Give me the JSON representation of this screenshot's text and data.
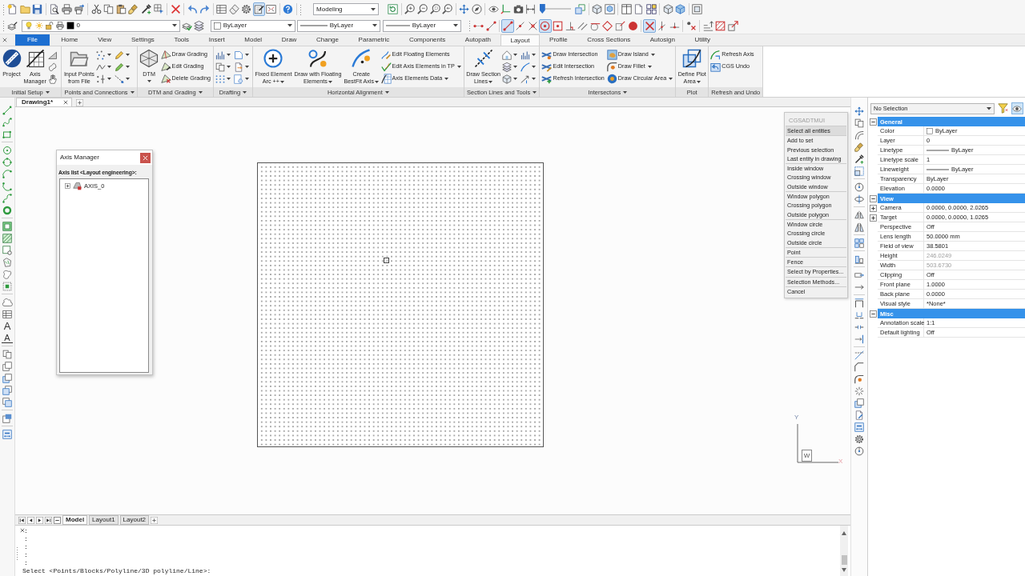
{
  "standard_toolbar": {
    "buttons": [
      {
        "on": false
      },
      {
        "on": false
      },
      {
        "on": false
      },
      {
        "on": false
      },
      {
        "on": false
      },
      {
        "on": false
      },
      {
        "on": false
      },
      {
        "on": false
      },
      {
        "on": false
      },
      {
        "on": false
      },
      {
        "on": false
      },
      {
        "on": false
      },
      {
        "on": false
      },
      {
        "on": false
      },
      {
        "on": false
      },
      {
        "on": false
      },
      {
        "on": false
      },
      {
        "on": false
      },
      {
        "on": true
      },
      {
        "on": false
      },
      {
        "on": false
      }
    ],
    "workspace": "Modeling",
    "view_buttons": [
      {
        "on": false
      },
      {
        "on": false
      },
      {
        "on": false
      },
      {
        "on": false
      },
      {
        "on": false
      },
      {
        "on": false
      },
      {
        "on": false
      },
      {
        "on": false
      },
      {
        "on": false
      },
      {
        "on": false
      },
      {
        "on": false
      },
      {
        "on": false
      },
      {
        "on": false
      },
      {
        "on": false
      },
      {
        "on": false
      },
      {
        "on": false
      },
      {
        "on": false
      },
      {
        "on": false
      },
      {
        "on": false
      },
      {
        "on": false
      }
    ],
    "visual_slider": {
      "level": 0
    }
  },
  "property_toolbar": {
    "layer": "0",
    "color_setting": "ByLayer",
    "linetype": "ByLayer",
    "lineweight": "ByLayer"
  },
  "snap_toolbar": {
    "buttons": [
      {
        "on": false
      },
      {
        "on": false
      },
      {
        "on": true
      },
      {
        "on": false
      },
      {
        "on": false
      },
      {
        "on": true
      },
      {
        "on": false
      },
      {
        "on": false
      },
      {
        "on": false
      },
      {
        "on": false
      },
      {
        "on": false
      },
      {
        "on": false
      },
      {
        "on": false
      },
      {
        "on": true
      },
      {
        "on": false
      },
      {
        "on": false
      },
      {
        "on": false
      },
      {
        "on": false
      },
      {
        "on": false
      },
      {
        "on": false
      }
    ]
  },
  "ribbon_tabs": [
    {
      "label": "File",
      "kind": "application",
      "selected": false
    },
    {
      "label": "Home",
      "kind": "tab",
      "selected": false
    },
    {
      "label": "View",
      "kind": "tab",
      "selected": false
    },
    {
      "label": "Settings",
      "kind": "tab",
      "selected": false
    },
    {
      "label": "Tools",
      "kind": "tab",
      "selected": false
    },
    {
      "label": "Insert",
      "kind": "tab",
      "selected": false
    },
    {
      "label": "Model",
      "kind": "tab",
      "selected": false
    },
    {
      "label": "Draw",
      "kind": "tab",
      "selected": false
    },
    {
      "label": "Change",
      "kind": "tab",
      "selected": false
    },
    {
      "label": "Parametric",
      "kind": "tab",
      "selected": false
    },
    {
      "label": "Components",
      "kind": "tab",
      "selected": false
    },
    {
      "label": "Autopath",
      "kind": "tab",
      "selected": false
    },
    {
      "label": "Layout",
      "kind": "tab",
      "selected": true
    },
    {
      "label": "Profile",
      "kind": "tab",
      "selected": false
    },
    {
      "label": "Cross Sections",
      "kind": "tab",
      "selected": false
    },
    {
      "label": "Autosign",
      "kind": "tab",
      "selected": false
    },
    {
      "label": "Utility",
      "kind": "tab",
      "selected": false
    }
  ],
  "ribbon_groups": [
    {
      "label": "Initial Setup",
      "menu": true,
      "tools": [
        {
          "kind": "large",
          "label": "Project",
          "menu": false
        },
        {
          "kind": "large",
          "label": "Axis\nManager",
          "menu": false
        },
        {
          "kind": "icon",
          "menu": false
        },
        {
          "kind": "icon",
          "menu": false
        },
        {
          "kind": "icon",
          "menu": false
        }
      ]
    },
    {
      "label": "Points and Connections",
      "menu": true,
      "tools": [
        {
          "kind": "large",
          "label": "Input Points\nfrom File",
          "menu": false
        },
        {
          "kind": "icon",
          "menu": true
        },
        {
          "kind": "icon",
          "menu": true
        },
        {
          "kind": "icon",
          "menu": true
        },
        {
          "kind": "icon",
          "menu": true
        },
        {
          "kind": "icon",
          "menu": true
        },
        {
          "kind": "icon",
          "menu": true
        }
      ]
    },
    {
      "label": "DTM and Grading",
      "menu": true,
      "tools": [
        {
          "kind": "large",
          "label": "DTM",
          "menu": true
        },
        {
          "kind": "small",
          "label": "Draw Grading",
          "menu": false
        },
        {
          "kind": "small",
          "label": "Edit Grading",
          "menu": false
        },
        {
          "kind": "small",
          "label": "Delete Grading",
          "menu": false
        }
      ]
    },
    {
      "label": "Drafting",
      "menu": true,
      "tools": [
        {
          "kind": "icon",
          "menu": true
        },
        {
          "kind": "icon",
          "menu": true
        },
        {
          "kind": "icon",
          "menu": true
        },
        {
          "kind": "icon",
          "menu": true
        },
        {
          "kind": "icon",
          "menu": true
        },
        {
          "kind": "icon",
          "menu": true
        }
      ]
    },
    {
      "label": "Horizontal Alignment",
      "menu": true,
      "tools": [
        {
          "kind": "large",
          "label": "Fixed Element\nArc ++",
          "menu": true
        },
        {
          "kind": "large",
          "label": "Draw with Floating\nElements",
          "menu": true
        },
        {
          "kind": "large",
          "label": "Create\nBestFit Axis",
          "menu": true
        },
        {
          "kind": "small",
          "label": "Edit Floating Elements",
          "menu": false
        },
        {
          "kind": "small",
          "label": "Edit Axis Elements in TP",
          "menu": true
        },
        {
          "kind": "small",
          "label": "Axis Elements Data",
          "menu": true
        }
      ]
    },
    {
      "label": "Section Lines and Tools",
      "menu": true,
      "tools": [
        {
          "kind": "large",
          "label": "Draw Section\nLines",
          "menu": true
        },
        {
          "kind": "icon",
          "menu": true
        },
        {
          "kind": "icon",
          "menu": true
        },
        {
          "kind": "icon",
          "menu": true
        },
        {
          "kind": "icon",
          "menu": true
        },
        {
          "kind": "icon",
          "menu": true
        },
        {
          "kind": "icon",
          "menu": true
        }
      ]
    },
    {
      "label": "Intersectons",
      "menu": true,
      "tools": [
        {
          "kind": "small",
          "label": "Draw Intersection",
          "menu": false
        },
        {
          "kind": "small",
          "label": "Edit Intersection",
          "menu": false
        },
        {
          "kind": "small",
          "label": "Refresh Intersection",
          "menu": false
        },
        {
          "kind": "small",
          "label": "Draw Island",
          "menu": true
        },
        {
          "kind": "small",
          "label": "Draw Fillet",
          "menu": true
        },
        {
          "kind": "small",
          "label": "Draw Circular Area",
          "menu": true
        }
      ]
    },
    {
      "label": "Plot",
      "menu": false,
      "tools": [
        {
          "kind": "large",
          "label": "Define Plot\nArea",
          "menu": true
        }
      ]
    },
    {
      "label": "Refresh and Undo",
      "menu": false,
      "tools": [
        {
          "kind": "small",
          "label": "Refresh Axis",
          "menu": false
        },
        {
          "kind": "small",
          "label": "CGS Undo",
          "menu": false
        }
      ]
    }
  ],
  "document_tabs": [
    {
      "label": "Drawing1*",
      "selected": true
    }
  ],
  "draw_toolbar": {
    "text_tools": [
      {
        "glyph": "A",
        "kind": "single_line"
      },
      {
        "glyph": "A",
        "kind": "multiline"
      }
    ]
  },
  "axis_manager": {
    "title": "Axis Manager",
    "list_label": "Axis list <Layout engineering>:",
    "axes": [
      {
        "label": "AXIS_0",
        "expanded": false
      }
    ]
  },
  "selection_menu": {
    "title": "CGSADTMUI",
    "groups": [
      {
        "items": [
          {
            "label": "Select all entities",
            "selected": true
          }
        ]
      },
      {
        "items": [
          {
            "label": "Add to set",
            "selected": false
          },
          {
            "label": "Previous selection",
            "selected": false
          },
          {
            "label": "Last entity in drawing",
            "selected": false
          }
        ]
      },
      {
        "items": [
          {
            "label": "Inside window",
            "selected": false
          },
          {
            "label": "Crossing window",
            "selected": false
          },
          {
            "label": "Outside window",
            "selected": false
          }
        ]
      },
      {
        "items": [
          {
            "label": "Window polygon",
            "selected": false
          },
          {
            "label": "Crossing polygon",
            "selected": false
          },
          {
            "label": "Outside polygon",
            "selected": false
          }
        ]
      },
      {
        "items": [
          {
            "label": "Window circle",
            "selected": false
          },
          {
            "label": "Crossing circle",
            "selected": false
          },
          {
            "label": "Outside circle",
            "selected": false
          }
        ]
      },
      {
        "items": [
          {
            "label": "Point",
            "selected": false
          }
        ]
      },
      {
        "items": [
          {
            "label": "Fence",
            "selected": false
          }
        ]
      },
      {
        "items": [
          {
            "label": "Select by Properties...",
            "selected": false
          }
        ]
      },
      {
        "items": [
          {
            "label": "Selection Methods...",
            "selected": false
          }
        ]
      },
      {
        "items": [
          {
            "label": "Cancel",
            "selected": false
          }
        ]
      }
    ]
  },
  "ucs": {
    "y_label": "Y",
    "w_label": "W",
    "x_label": "X"
  },
  "layout_tabs": [
    {
      "label": "Model",
      "selected": true
    },
    {
      "label": "Layout1",
      "selected": false
    },
    {
      "label": "Layout2",
      "selected": false
    }
  ],
  "command_line": {
    "history": [
      ":",
      ":",
      ":",
      ":",
      ":"
    ],
    "prompt": "Select <Points/Blocks/Polyline/3D polyline/Line>:"
  },
  "properties": {
    "selector": "No Selection",
    "view_toggle": {
      "on": true
    },
    "sections": [
      {
        "title": "General",
        "expanded": true,
        "rows": [
          {
            "label": "Color",
            "value": "ByLayer",
            "kind": "color",
            "disabled": false
          },
          {
            "label": "Layer",
            "value": "0",
            "kind": "text",
            "disabled": false
          },
          {
            "label": "Linetype",
            "value": "ByLayer",
            "kind": "line",
            "disabled": false
          },
          {
            "label": "Linetype scale",
            "value": "1",
            "kind": "text",
            "disabled": false
          },
          {
            "label": "Lineweight",
            "value": "ByLayer",
            "kind": "line",
            "disabled": false
          },
          {
            "label": "Transparency",
            "value": "ByLayer",
            "kind": "text",
            "disabled": false
          },
          {
            "label": "Elevation",
            "value": "0.0000",
            "kind": "text",
            "disabled": false
          }
        ]
      },
      {
        "title": "View",
        "expanded": true,
        "rows": [
          {
            "label": "Camera",
            "value": "0.0000, 0.0000, 2.0265",
            "kind": "text",
            "disabled": false,
            "expanded": false
          },
          {
            "label": "Target",
            "value": "0.0000, 0.0000, 1.0265",
            "kind": "text",
            "disabled": false,
            "expanded": false
          },
          {
            "label": "Perspective",
            "value": "Off",
            "kind": "text",
            "disabled": false
          },
          {
            "label": "Lens length",
            "value": "50.0000 mm",
            "kind": "text",
            "disabled": false
          },
          {
            "label": "Field of view",
            "value": "38.5801",
            "kind": "text",
            "disabled": false
          },
          {
            "label": "Height",
            "value": "246.0249",
            "kind": "text",
            "disabled": true
          },
          {
            "label": "Width",
            "value": "503.6730",
            "kind": "text",
            "disabled": true
          },
          {
            "label": "Clipping",
            "value": "Off",
            "kind": "text",
            "disabled": false
          },
          {
            "label": "Front plane",
            "value": "1.0000",
            "kind": "text",
            "disabled": false
          },
          {
            "label": "Back plane",
            "value": "0.0000",
            "kind": "text",
            "disabled": false
          },
          {
            "label": "Visual style",
            "value": "*None*",
            "kind": "text",
            "disabled": false
          }
        ]
      },
      {
        "title": "Misc",
        "expanded": true,
        "rows": [
          {
            "label": "Annotation scale",
            "value": "1:1",
            "kind": "text",
            "disabled": false
          },
          {
            "label": "Default lighting",
            "value": "Off",
            "kind": "text",
            "disabled": false
          }
        ]
      }
    ]
  }
}
